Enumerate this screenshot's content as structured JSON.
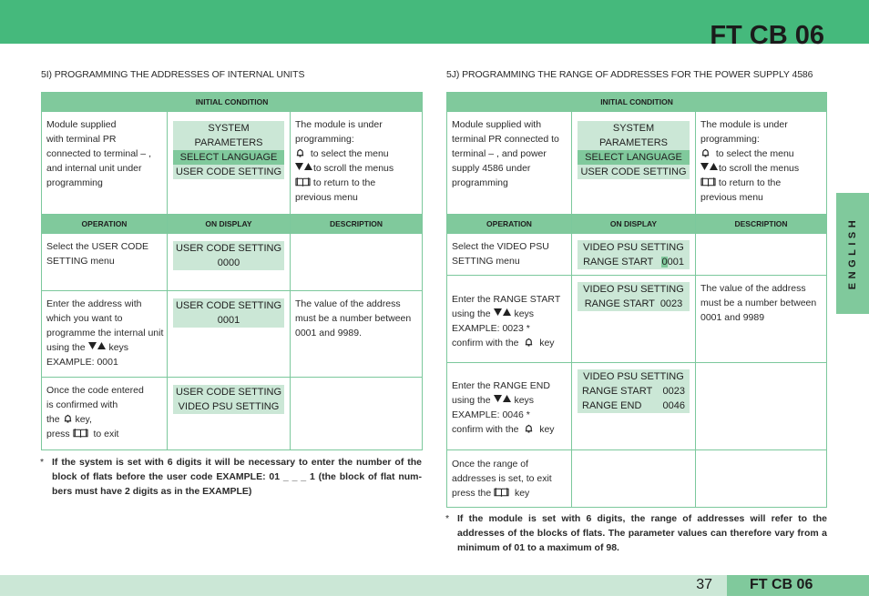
{
  "header": {
    "title": "FT CB 06"
  },
  "side_tab": {
    "label": "ENGLISH"
  },
  "footer": {
    "page_number": "37",
    "title": "FT CB 06"
  },
  "colors": {
    "brand_green": "#45b97c",
    "table_green": "#80c99c",
    "light_green": "#cbe7d6"
  },
  "left": {
    "section_title": "5I) PROGRAMMING THE ADDRESSES OF INTERNAL UNITS",
    "initial_header": "INITIAL CONDITION",
    "initial": {
      "operation": [
        "Module supplied",
        "with terminal PR",
        "connected to terminal – ,",
        "and internal unit under",
        "programming"
      ],
      "display": [
        "SYSTEM PARAMETERS",
        "SELECT LANGUAGE",
        "USER CODE SETTING"
      ],
      "description": {
        "line1": "The module is under",
        "line2": "programming:",
        "bell": "to select the menu",
        "arrows": "to scroll the menus",
        "book": "to return to the",
        "line6": "previous menu"
      }
    },
    "columns": [
      "OPERATION",
      "ON DISPLAY",
      "DESCRIPTION"
    ],
    "rows": [
      {
        "operation": [
          "Select the USER CODE",
          "SETTING menu"
        ],
        "display": [
          "USER CODE SETTING",
          "0000"
        ],
        "description": []
      },
      {
        "operation": [
          "Enter the address with",
          "which you want to",
          "programme the internal unit",
          "using the",
          "keys",
          "EXAMPLE: 0001"
        ],
        "display": [
          "USER CODE SETTING",
          "0001"
        ],
        "description": [
          "The value of the address",
          "must be a number between",
          "0001 and 9989."
        ]
      },
      {
        "operation": [
          "Once the code entered",
          "is confirmed with",
          "the",
          "key,",
          "press",
          "to exit"
        ],
        "display": [
          "USER CODE SETTING",
          "VIDEO PSU SETTING"
        ],
        "description": []
      }
    ],
    "footnote": {
      "star": "*",
      "text": "If the system is set with 6 digits it will be necessary to enter the number of the block of flats before the user code EXAMPLE: 01 _ _ _ 1 (the block of flat num-bers must have 2 digits as in the EXAMPLE)"
    }
  },
  "right": {
    "section_title": "5J) PROGRAMMING THE RANGE OF ADDRESSES FOR THE POWER SUPPLY 4586",
    "initial_header": "INITIAL CONDITION",
    "initial": {
      "operation": [
        "Module supplied with",
        "terminal PR connected to",
        "terminal – , and power",
        "supply 4586 under",
        "programming"
      ],
      "display": [
        "SYSTEM PARAMETERS",
        "SELECT LANGUAGE",
        "USER CODE SETTING"
      ],
      "description": {
        "line1": "The module is under",
        "line2": "programming:",
        "bell": "to select the menu",
        "arrows": "to scroll the menus",
        "book": "to return to the",
        "line6": "previous menu"
      }
    },
    "columns": [
      "OPERATION",
      "ON DISPLAY",
      "DESCRIPTION"
    ],
    "rows": [
      {
        "operation": [
          "Select the VIDEO PSU",
          "SETTING menu"
        ],
        "display": {
          "line1": "VIDEO PSU SETTING",
          "label2": "RANGE START",
          "cursor_digit": "0",
          "value2_rest": "001"
        },
        "description": []
      },
      {
        "operation": [
          "Enter the RANGE START",
          "using the",
          "keys",
          "EXAMPLE: 0023 *",
          "confirm with the",
          "key"
        ],
        "display": {
          "line1": "VIDEO PSU SETTING",
          "line2": "RANGE START  0023"
        },
        "description": [
          "The value of the address",
          "must be a number between",
          "0001 and 9989"
        ]
      },
      {
        "operation": [
          "Enter the RANGE END",
          "using the",
          "keys",
          "EXAMPLE: 0046 *",
          "confirm with the",
          "key"
        ],
        "display": {
          "line1": "VIDEO PSU SETTING",
          "label2": "RANGE START",
          "value2": "0023",
          "label3": "RANGE END",
          "value3": "0046"
        },
        "description": []
      },
      {
        "operation": [
          "Once the range of",
          "addresses is set, to exit",
          "press the",
          "key"
        ],
        "display": [],
        "description": []
      }
    ],
    "footnote": {
      "star": "*",
      "text": "If the module is set with 6 digits, the range of addresses will refer to the addresses of the blocks of flats. The parameter values can therefore vary from a minimum of 01 to a maximum of 98."
    }
  },
  "icons": {
    "bell": "bell-icon",
    "arrows": "down-up-arrows-icon",
    "book": "book-icon"
  }
}
